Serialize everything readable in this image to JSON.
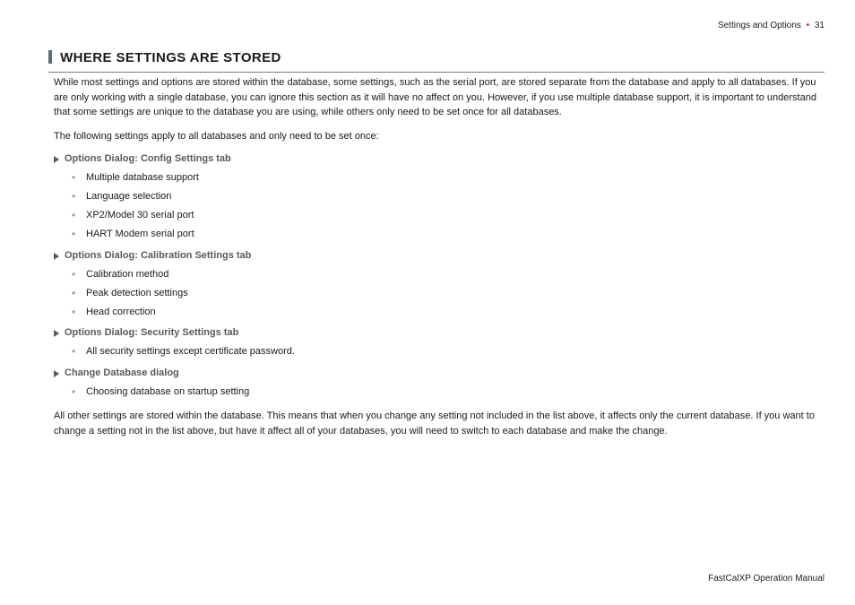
{
  "header": {
    "section_name": "Settings and Options",
    "page_number": "31"
  },
  "title": "WHERE SETTINGS ARE STORED",
  "intro_paragraph": "While most settings and options are stored within the database, some settings, such as the serial port, are stored separate from the database and apply to all databases. If you are only working with a single database, you can ignore this section as it will have no affect on you. However, if you use multiple database support, it is important to understand that some settings are unique to the database you are using, while others only need to be set once for all databases.",
  "lead_in": "The following settings apply to all databases and only need to be set once:",
  "groups": [
    {
      "heading": "Options Dialog: Config Settings tab",
      "items": [
        "Multiple database support",
        "Language selection",
        "XP2/Model 30 serial port",
        "HART Modem serial port"
      ]
    },
    {
      "heading": "Options Dialog: Calibration Settings tab",
      "items": [
        "Calibration method",
        "Peak detection settings",
        "Head correction"
      ]
    },
    {
      "heading": "Options Dialog: Security Settings tab",
      "items": [
        "All security settings except certificate password."
      ]
    },
    {
      "heading": "Change Database dialog",
      "items": [
        "Choosing database on startup setting"
      ]
    }
  ],
  "closing_paragraph": "All other settings are stored within the database. This means that when you change any setting not included in the list above, it affects only the current database. If you want to change a setting not in the list above, but have it affect all of your databases, you will need to switch to each database and make the change.",
  "footer": "FastCalXP Operation Manual"
}
